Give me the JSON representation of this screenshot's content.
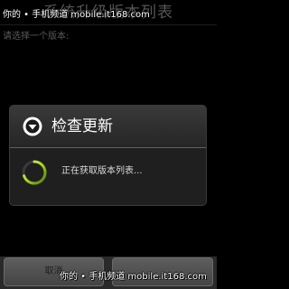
{
  "app": {
    "title": "系统升级版本列表",
    "prompt": "请选择一个版本:"
  },
  "dialog": {
    "icon": "chevron-down-icon",
    "title": "检查更新",
    "message": "正在获取版本列表..."
  },
  "buttons": {
    "cancel_label": "取消",
    "right_label": ""
  },
  "watermarks": {
    "top": "你的 • 手机频道 mobile.it168.com",
    "bottom": "你的 • 手机频道 mobile.it168.com"
  },
  "colors": {
    "spinner_accent": "#a6d81c",
    "dialog_title": "#ffffff"
  }
}
